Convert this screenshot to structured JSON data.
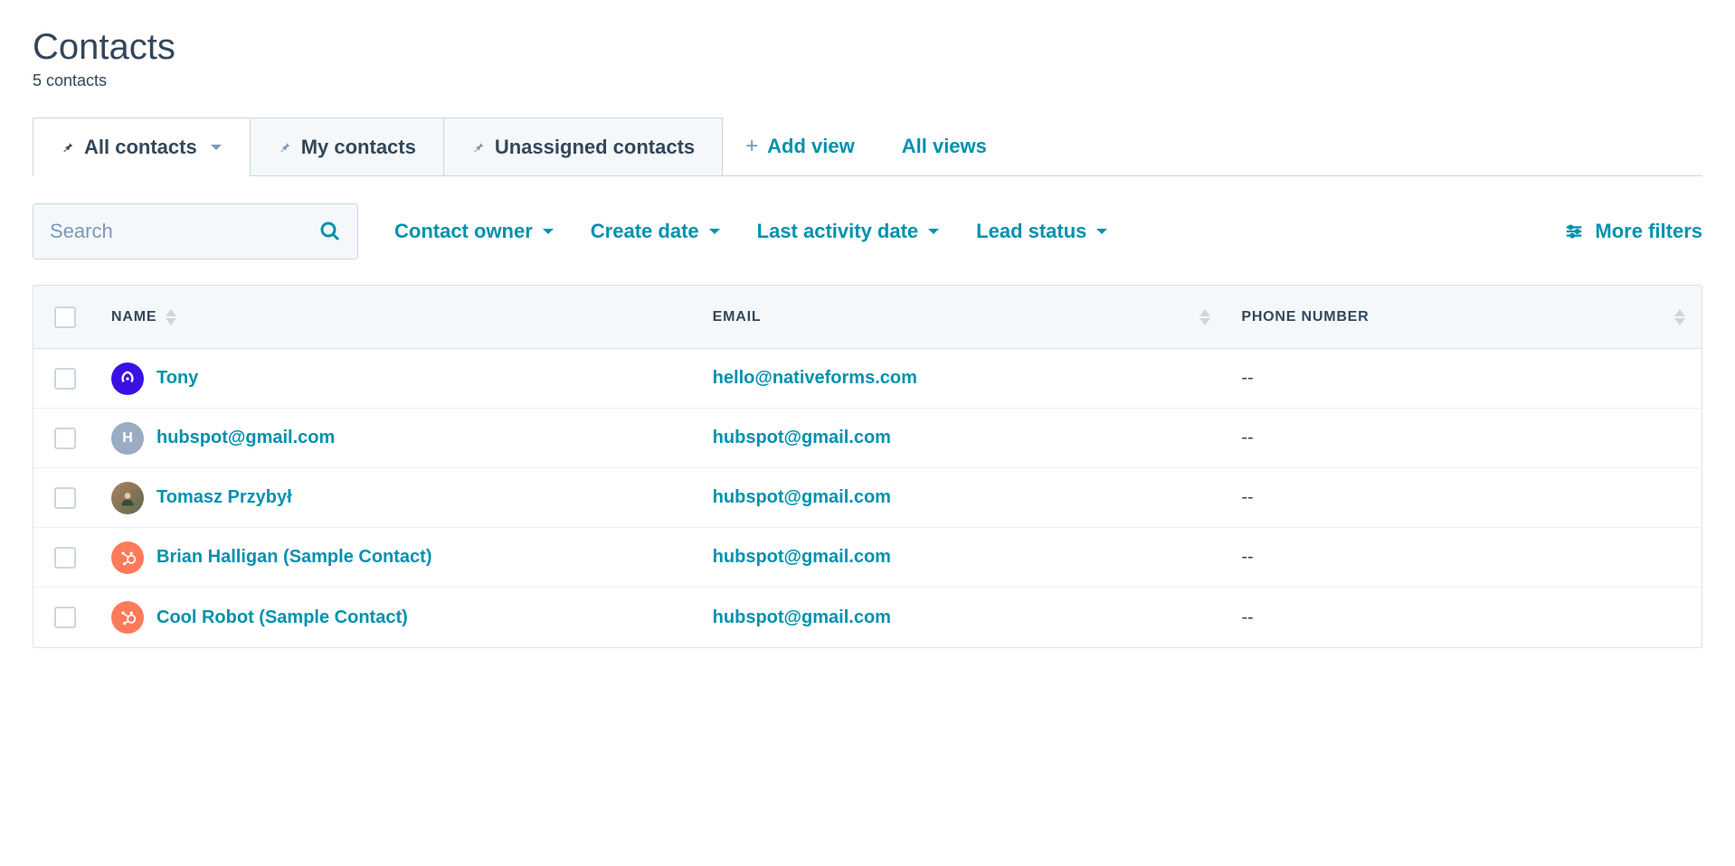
{
  "header": {
    "title": "Contacts",
    "subtitle": "5 contacts"
  },
  "tabs": {
    "items": [
      {
        "label": "All contacts",
        "active": true,
        "has_dropdown": true
      },
      {
        "label": "My contacts",
        "active": false,
        "has_dropdown": false
      },
      {
        "label": "Unassigned contacts",
        "active": false,
        "has_dropdown": false
      }
    ],
    "add_view": "Add view",
    "all_views": "All views"
  },
  "search": {
    "placeholder": "Search"
  },
  "filters": {
    "contact_owner": "Contact owner",
    "create_date": "Create date",
    "last_activity": "Last activity date",
    "lead_status": "Lead status",
    "more_filters": "More filters"
  },
  "table": {
    "columns": {
      "name": "NAME",
      "email": "EMAIL",
      "phone": "PHONE NUMBER"
    },
    "rows": [
      {
        "name": "Tony",
        "email": "hello@nativeforms.com",
        "phone": "--",
        "avatar_type": "blue",
        "avatar_letter": ""
      },
      {
        "name": "hubspot@gmail.com",
        "email": "hubspot@gmail.com",
        "phone": "--",
        "avatar_type": "grey",
        "avatar_letter": "H"
      },
      {
        "name": "Tomasz Przybył",
        "email": "hubspot@gmail.com",
        "phone": "--",
        "avatar_type": "photo",
        "avatar_letter": ""
      },
      {
        "name": "Brian Halligan (Sample Contact)",
        "email": "hubspot@gmail.com",
        "phone": "--",
        "avatar_type": "orange",
        "avatar_letter": ""
      },
      {
        "name": "Cool Robot (Sample Contact)",
        "email": "hubspot@gmail.com",
        "phone": "--",
        "avatar_type": "orange",
        "avatar_letter": ""
      }
    ]
  }
}
